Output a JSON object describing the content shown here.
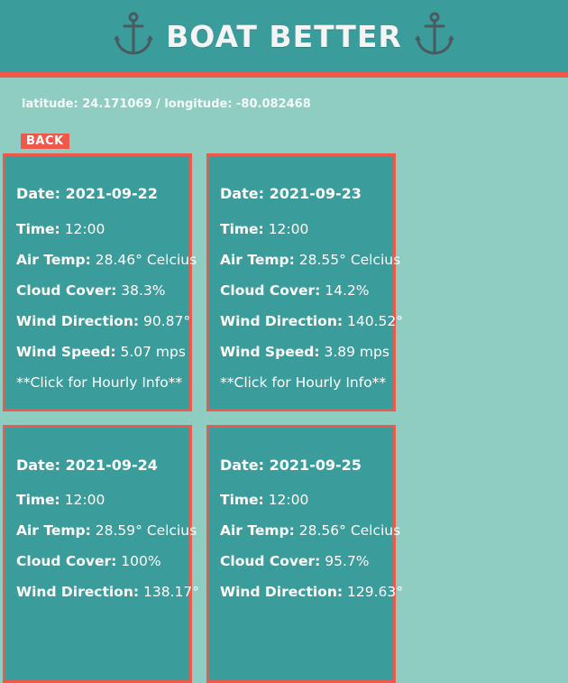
{
  "header": {
    "title": "BOAT BETTER",
    "accent_color": "#f0594a",
    "header_color": "#3b9c9c",
    "icon": "anchor-icon"
  },
  "location": {
    "text": "latitude: 24.171069 / longitude: -80.082468"
  },
  "back_button": {
    "label": "BACK"
  },
  "labels": {
    "date": "Date:",
    "time": "Time:",
    "air_temp": "Air Temp:",
    "cloud_cover": "Cloud Cover:",
    "wind_direction": "Wind Direction:",
    "wind_speed": "Wind Speed:"
  },
  "cards": [
    {
      "date": "2021-09-22",
      "time": "12:00",
      "air_temp": "28.46° Celcius",
      "cloud_cover": "38.3%",
      "wind_direction": "90.87°",
      "wind_speed": "5.07 mps",
      "cta": "**Click for Hourly Info**"
    },
    {
      "date": "2021-09-23",
      "time": "12:00",
      "air_temp": "28.55° Celcius",
      "cloud_cover": "14.2%",
      "wind_direction": "140.52°",
      "wind_speed": "3.89 mps",
      "cta": "**Click for Hourly Info**"
    },
    {
      "date": "2021-09-24",
      "time": "12:00",
      "air_temp": "28.59° Celcius",
      "cloud_cover": "100%",
      "wind_direction": "138.17°"
    },
    {
      "date": "2021-09-25",
      "time": "12:00",
      "air_temp": "28.56° Celcius",
      "cloud_cover": "95.7%",
      "wind_direction": "129.63°"
    }
  ]
}
